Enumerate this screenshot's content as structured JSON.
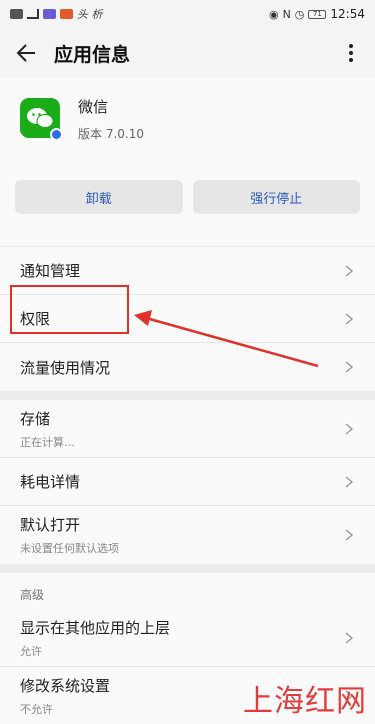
{
  "status_bar": {
    "app_name": "头 析",
    "battery": "71",
    "time": "12:54"
  },
  "header": {
    "title": "应用信息"
  },
  "app": {
    "name": "微信",
    "version": "版本 7.0.10",
    "icon": "wechat-icon"
  },
  "actions": {
    "uninstall": "卸载",
    "force_stop": "强行停止"
  },
  "group1": [
    {
      "label": "通知管理"
    },
    {
      "label": "权限"
    },
    {
      "label": "流量使用情况"
    }
  ],
  "group2": [
    {
      "label": "存储",
      "sub": "正在计算..."
    },
    {
      "label": "耗电详情"
    },
    {
      "label": "默认打开",
      "sub": "未设置任何默认选项"
    }
  ],
  "advanced": {
    "header": "高级",
    "items": [
      {
        "label": "显示在其他应用的上层",
        "sub": "允许"
      },
      {
        "label": "修改系统设置",
        "sub": "不允许"
      }
    ]
  },
  "watermark": "上海红网",
  "colors": {
    "accent_text": "#2a5bbf",
    "highlight": "#e0322b",
    "app_green": "#1aad19"
  }
}
